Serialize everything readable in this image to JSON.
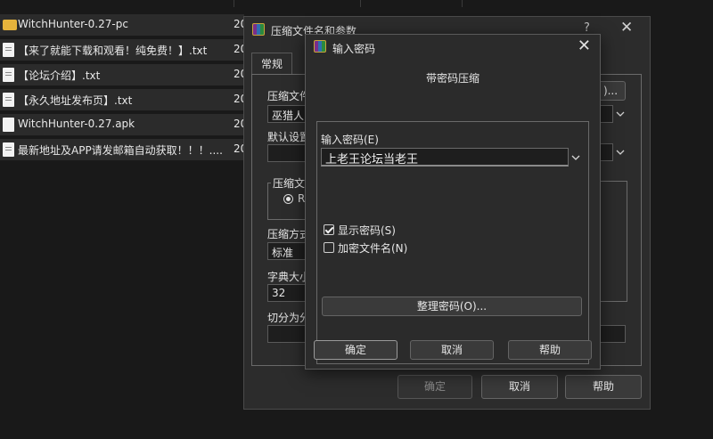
{
  "explorer": {
    "rows": [
      {
        "name": "WitchHunter-0.27-pc",
        "icon": "folder-icon",
        "date": "20"
      },
      {
        "name": "【来了就能下载和观看！纯免费！】.txt",
        "icon": "text-file-icon",
        "date": "20"
      },
      {
        "name": "【论坛介绍】.txt",
        "icon": "text-file-icon",
        "date": "20"
      },
      {
        "name": "【永久地址发布页】.txt",
        "icon": "text-file-icon",
        "date": "20"
      },
      {
        "name": "WitchHunter-0.27.apk",
        "icon": "apk-file-icon",
        "date": "20"
      },
      {
        "name": "最新地址及APP请发邮箱自动获取！！！....",
        "icon": "text-file-icon",
        "date": "20"
      }
    ]
  },
  "archive_dialog": {
    "title": "压缩文件名和参数",
    "help_glyph": "?",
    "tab_general": "常规",
    "archive_name_label": "压缩文件",
    "archive_name_value": "巫猎人",
    "browse_label": ")...",
    "default_settings_label": "默认设置",
    "format_group_label": "压缩文",
    "format_option": "R",
    "method_label": "压缩方式",
    "method_value": "标准",
    "dict_label": "字典大小",
    "dict_value": "32",
    "split_label": "切分为分",
    "ok_label": "确定",
    "cancel_label": "取消",
    "help_label": "帮助"
  },
  "password_dialog": {
    "title": "输入密码",
    "heading": "带密码压缩",
    "password_label": "输入密码(E)",
    "password_value": "上老王论坛当老王",
    "show_password_label": "显示密码(S)",
    "show_password_checked": true,
    "encrypt_names_label": "加密文件名(N)",
    "encrypt_names_checked": false,
    "organize_label": "整理密码(O)...",
    "ok_label": "确定",
    "cancel_label": "取消",
    "help_label": "帮助"
  }
}
